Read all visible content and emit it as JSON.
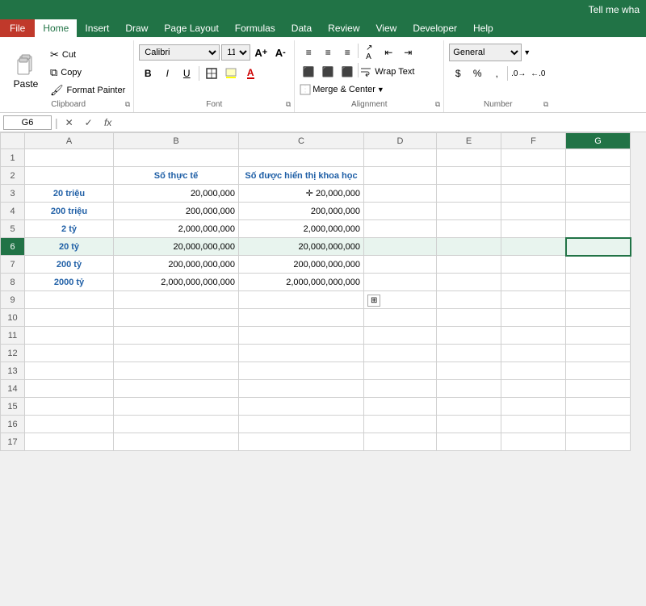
{
  "titleBar": {
    "title": "Tell me wha"
  },
  "menuBar": {
    "items": [
      {
        "label": "File",
        "active": false,
        "isFile": true
      },
      {
        "label": "Home",
        "active": true
      },
      {
        "label": "Insert",
        "active": false
      },
      {
        "label": "Draw",
        "active": false
      },
      {
        "label": "Page Layout",
        "active": false
      },
      {
        "label": "Formulas",
        "active": false
      },
      {
        "label": "Data",
        "active": false
      },
      {
        "label": "Review",
        "active": false
      },
      {
        "label": "View",
        "active": false
      },
      {
        "label": "Developer",
        "active": false
      },
      {
        "label": "Help",
        "active": false
      }
    ]
  },
  "ribbon": {
    "clipboard": {
      "pasteLabel": "Paste",
      "cutLabel": "Cut",
      "copyLabel": "Copy",
      "formatPainterLabel": "Format Painter",
      "groupLabel": "Clipboard"
    },
    "font": {
      "fontName": "Calibri",
      "fontSize": "11",
      "bold": "B",
      "italic": "I",
      "underline": "U",
      "groupLabel": "Font"
    },
    "alignment": {
      "wrapText": "Wrap Text",
      "mergeCenterLabel": "Merge & Center",
      "groupLabel": "Alignment"
    },
    "number": {
      "format": "General",
      "groupLabel": "Number"
    }
  },
  "formulaBar": {
    "cellRef": "G6",
    "formula": ""
  },
  "columns": {
    "headers": [
      "A",
      "B",
      "C",
      "D",
      "E",
      "F",
      "G"
    ],
    "activeCol": "G"
  },
  "rows": [
    {
      "num": 1,
      "cells": [
        "",
        "",
        "",
        "",
        "",
        "",
        ""
      ]
    },
    {
      "num": 2,
      "cells": [
        "",
        "Số thực tế",
        "Số được hiển thị khoa học",
        "",
        "",
        "",
        ""
      ]
    },
    {
      "num": 3,
      "cells": [
        "20 triệu",
        "20,000,000",
        "✛ 20,000,000",
        "",
        "",
        "",
        ""
      ]
    },
    {
      "num": 4,
      "cells": [
        "200 triệu",
        "200,000,000",
        "200,000,000",
        "",
        "",
        "",
        ""
      ]
    },
    {
      "num": 5,
      "cells": [
        "2 tỷ",
        "2,000,000,000",
        "2,000,000,000",
        "",
        "",
        "",
        ""
      ]
    },
    {
      "num": 6,
      "cells": [
        "20 tỷ",
        "20,000,000,000",
        "20,000,000,000",
        "",
        "",
        "",
        ""
      ]
    },
    {
      "num": 7,
      "cells": [
        "200 tỷ",
        "200,000,000,000",
        "200,000,000,000",
        "",
        "",
        "",
        ""
      ]
    },
    {
      "num": 8,
      "cells": [
        "2000 tỷ",
        "2,000,000,000,000",
        "2,000,000,000,000",
        "",
        "",
        "",
        ""
      ]
    },
    {
      "num": 9,
      "cells": [
        "",
        "",
        "",
        "",
        "",
        "",
        ""
      ]
    },
    {
      "num": 10,
      "cells": [
        "",
        "",
        "",
        "",
        "",
        "",
        ""
      ]
    },
    {
      "num": 11,
      "cells": [
        "",
        "",
        "",
        "",
        "",
        "",
        ""
      ]
    },
    {
      "num": 12,
      "cells": [
        "",
        "",
        "",
        "",
        "",
        "",
        ""
      ]
    },
    {
      "num": 13,
      "cells": [
        "",
        "",
        "",
        "",
        "",
        "",
        ""
      ]
    },
    {
      "num": 14,
      "cells": [
        "",
        "",
        "",
        "",
        "",
        "",
        ""
      ]
    },
    {
      "num": 15,
      "cells": [
        "",
        "",
        "",
        "",
        "",
        "",
        ""
      ]
    },
    {
      "num": 16,
      "cells": [
        "",
        "",
        "",
        "",
        "",
        "",
        ""
      ]
    },
    {
      "num": 17,
      "cells": [
        "",
        "",
        "",
        "",
        "",
        "",
        ""
      ]
    }
  ]
}
